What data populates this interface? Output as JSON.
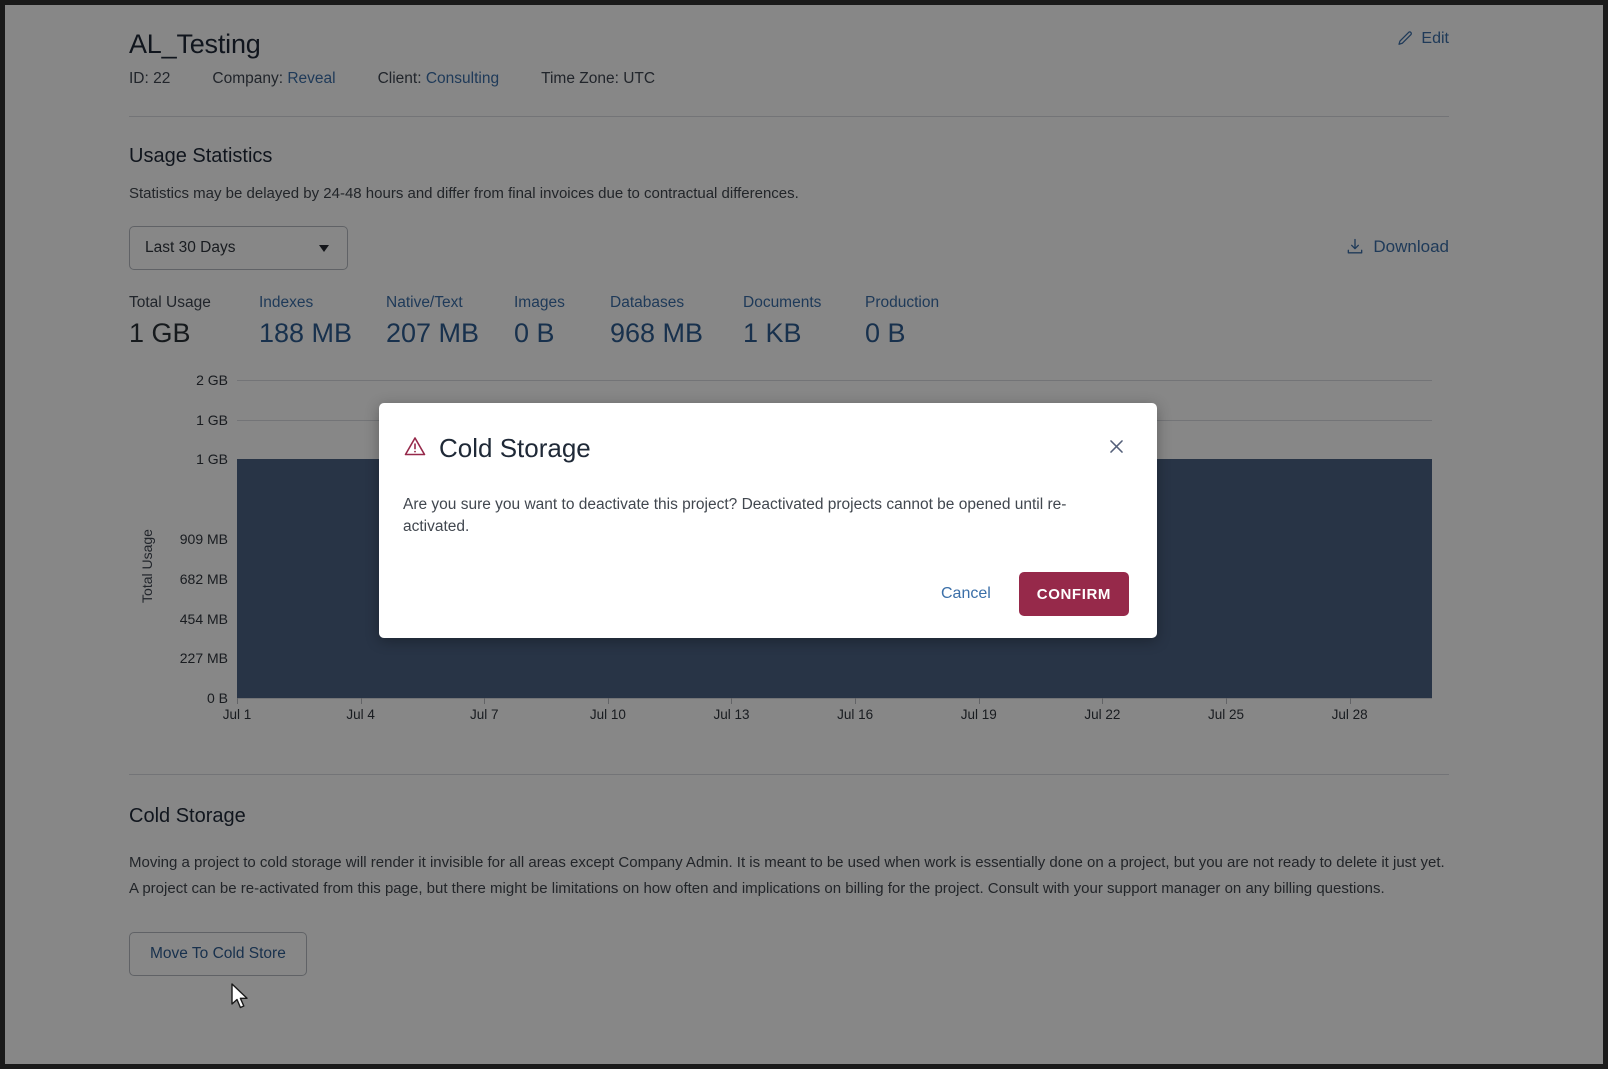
{
  "project": {
    "title": "AL_Testing",
    "meta": [
      {
        "label": "ID:",
        "value": "22",
        "is_link": false
      },
      {
        "label": "Company:",
        "value": "Reveal",
        "is_link": true
      },
      {
        "label": "Client:",
        "value": "Consulting",
        "is_link": true
      },
      {
        "label": "Time Zone:",
        "value": "UTC",
        "is_link": false
      }
    ],
    "edit_label": "Edit",
    "edit_icon": "pencil-icon"
  },
  "usage": {
    "heading": "Usage Statistics",
    "subtext": "Statistics may be delayed by 24-48 hours and differ from final invoices due to contractual differences.",
    "range_selected": "Last 30 Days",
    "range_options": [
      "Last 30 Days"
    ],
    "dropdown_icon": "chevron-down-icon",
    "download_label": "Download",
    "download_icon": "download-icon",
    "stats": [
      {
        "label": "Total Usage",
        "value": "1 GB",
        "kind": "total"
      },
      {
        "label": "Indexes",
        "value": "188 MB",
        "kind": "metric"
      },
      {
        "label": "Native/Text",
        "value": "207 MB",
        "kind": "metric"
      },
      {
        "label": "Images",
        "value": "0 B",
        "kind": "metric"
      },
      {
        "label": "Databases",
        "value": "968 MB",
        "kind": "metric"
      },
      {
        "label": "Documents",
        "value": "1 KB",
        "kind": "metric"
      },
      {
        "label": "Production",
        "value": "0 B",
        "kind": "metric"
      }
    ]
  },
  "chart_data": {
    "type": "area",
    "title": "",
    "xlabel": "",
    "ylabel": "Total Usage",
    "grid": true,
    "legend": "none",
    "ytick_labels": [
      "2 GB",
      "1 GB",
      "1 GB",
      "909 MB",
      "682 MB",
      "454 MB",
      "227 MB",
      "0 B"
    ],
    "ytick_values": [
      1818,
      1591,
      1364,
      909,
      682,
      454,
      227,
      0
    ],
    "ylim": [
      0,
      1818
    ],
    "ylim_unit": "MB",
    "categories": [
      "Jul 1",
      "Jul 4",
      "Jul 7",
      "Jul 10",
      "Jul 13",
      "Jul 16",
      "Jul 19",
      "Jul 22",
      "Jul 25",
      "Jul 28"
    ],
    "x": [
      "Jul 1",
      "Jul 2",
      "Jul 3",
      "Jul 4",
      "Jul 5",
      "Jul 6",
      "Jul 7",
      "Jul 8",
      "Jul 9",
      "Jul 10",
      "Jul 11",
      "Jul 12",
      "Jul 13",
      "Jul 14",
      "Jul 15",
      "Jul 16",
      "Jul 17",
      "Jul 18",
      "Jul 19",
      "Jul 20",
      "Jul 21",
      "Jul 22",
      "Jul 23",
      "Jul 24",
      "Jul 25",
      "Jul 26",
      "Jul 27",
      "Jul 28",
      "Jul 29",
      "Jul 30"
    ],
    "series": [
      {
        "name": "Total Usage",
        "color": "#4d6384",
        "values": [
          1364,
          1364,
          1364,
          1364,
          1364,
          1364,
          1364,
          1364,
          1364,
          1364,
          1364,
          1364,
          1364,
          1364,
          1364,
          1364,
          1364,
          1364,
          1364,
          1364,
          1364,
          1364,
          1364,
          1364,
          1364,
          1364,
          1364,
          1364,
          1364,
          1364
        ]
      }
    ]
  },
  "cold_storage": {
    "heading": "Cold Storage",
    "body": "Moving a project to cold storage will render it invisible for all areas except Company Admin. It is meant to be used when work is essentially done on a project, but you are not ready to delete it just yet. A project can be re-activated from this page, but there might be limitations on how often and implications on billing for the project. Consult with your support manager on any billing questions.",
    "button_label": "Move To Cold Store"
  },
  "modal": {
    "title": "Cold Storage",
    "warning_icon": "warning-triangle-icon",
    "close_icon": "close-icon",
    "message": "Are you sure you want to deactivate this project? Deactivated projects cannot be opened until re-activated.",
    "cancel_label": "Cancel",
    "confirm_label": "CONFIRM"
  },
  "colors": {
    "link": "#3b6fa8",
    "accent_danger": "#96294a",
    "chart_area": "#4d6384",
    "text": "#1f2937"
  }
}
